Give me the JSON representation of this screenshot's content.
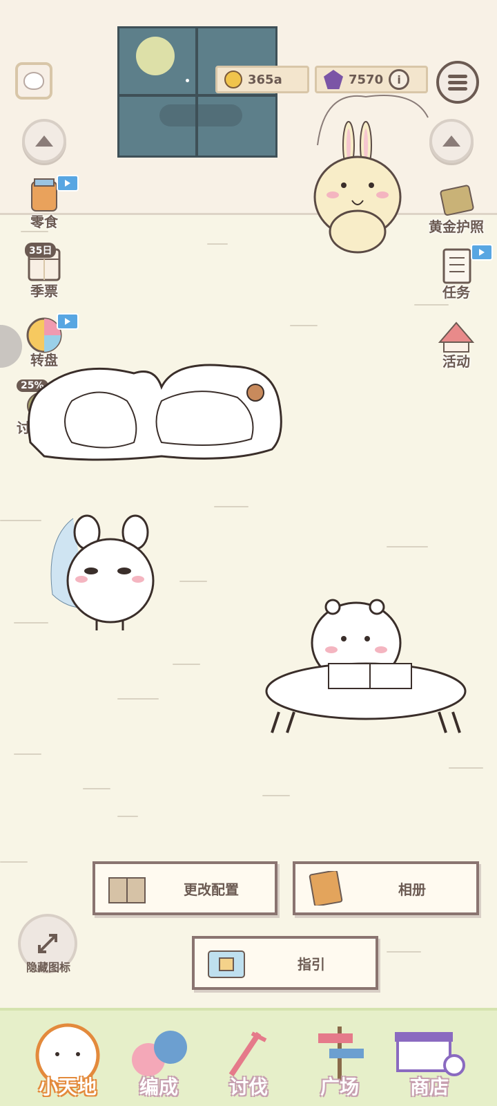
{
  "currency": {
    "coins": "365a",
    "gems": "7570"
  },
  "left_menu": [
    {
      "label": "零食",
      "video": true
    },
    {
      "label": "季票",
      "tag": "35日"
    },
    {
      "label": "转盘",
      "video": true
    },
    {
      "label": "讨伐奖励",
      "tag": "25%"
    }
  ],
  "right_menu": [
    {
      "label": "黄金护照"
    },
    {
      "label": "任务",
      "video": true
    },
    {
      "label": "活动"
    }
  ],
  "floor_buttons": {
    "change_layout": "更改配置",
    "album": "相册",
    "guide": "指引"
  },
  "hide_icons_label": "隐藏图标",
  "bottom_nav": [
    {
      "label": "小天地",
      "active": true
    },
    {
      "label": "编成"
    },
    {
      "label": "讨伐"
    },
    {
      "label": "广场"
    },
    {
      "label": "商店"
    }
  ],
  "colors": {
    "background": "#f8f5e6",
    "text": "#6b5a52",
    "nav_active_outline": "#e38a3c",
    "nav_outline": "#c7a0b0",
    "video_badge": "#58a6e2"
  }
}
